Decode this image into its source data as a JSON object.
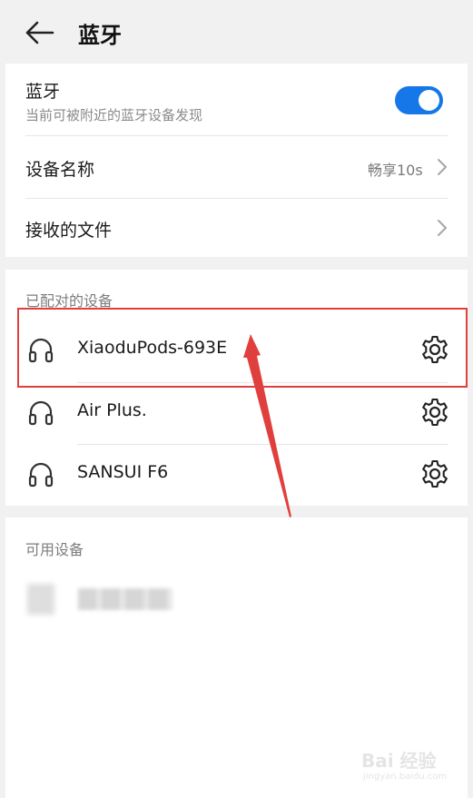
{
  "header": {
    "title": "蓝牙"
  },
  "settings": {
    "bluetooth": {
      "label": "蓝牙",
      "subtitle": "当前可被附近的蓝牙设备发现",
      "enabled": true
    },
    "device_name": {
      "label": "设备名称",
      "value": "畅享10s"
    },
    "received_files": {
      "label": "接收的文件"
    }
  },
  "paired": {
    "section_title": "已配对的设备",
    "devices": [
      {
        "name": "XiaoduPods-693E"
      },
      {
        "name": "Air Plus."
      },
      {
        "name": "SANSUI F6"
      }
    ]
  },
  "available": {
    "section_title": "可用设备"
  },
  "watermark": {
    "text": "Bai 经验",
    "sub": "jingyan.baidu.com"
  },
  "colors": {
    "accent": "#1677e8",
    "annotation": "#e0403d",
    "background": "#f1f1f1"
  }
}
